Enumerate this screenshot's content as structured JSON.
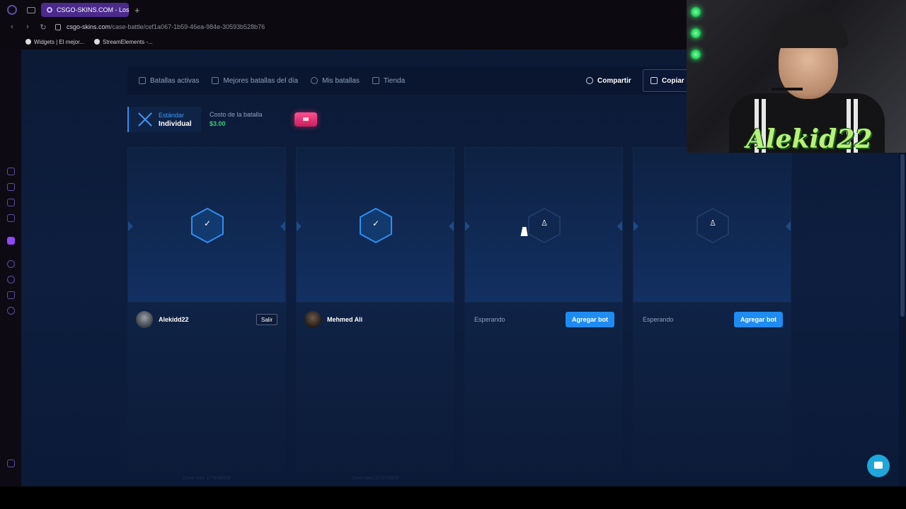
{
  "browser": {
    "tab_title": "CSGO-SKINS.COM - Los m",
    "url_host": "csgo-skins.com",
    "url_path": "/case-battle/cef1a067-1b59-46ea-984e-30593b528b76",
    "bookmarks": [
      {
        "label": "Widgets | El mejor..."
      },
      {
        "label": "StreamElements -..."
      }
    ]
  },
  "topnav": {
    "items": [
      {
        "label": "Batallas activas",
        "icon": "swords-icon"
      },
      {
        "label": "Mejores batallas del día",
        "icon": "trophy-icon"
      },
      {
        "label": "Mis batallas",
        "icon": "history-icon"
      },
      {
        "label": "Tienda",
        "icon": "basket-icon"
      }
    ],
    "share_label": "Compartir",
    "copy_label": "Copiar l"
  },
  "battle": {
    "mode_label": "Estándar",
    "mode_value": "Individual",
    "cost_label": "Costo de la batalla",
    "cost_value": "$3.00"
  },
  "slots": [
    {
      "state": "ready",
      "player": "Alekidd22",
      "action": "Salir",
      "seed": "Client seed: 1774058978"
    },
    {
      "state": "ready",
      "player": "Mehmed Ali",
      "action": "",
      "seed": "Client seed: 1776719509"
    },
    {
      "state": "waiting",
      "status": "Esperando",
      "action": "Agregar bot",
      "seed": ""
    },
    {
      "state": "waiting",
      "status": "Esperando",
      "action": "Agregar bot",
      "seed": ""
    }
  ],
  "webcam": {
    "overlay_name": "Alekid22"
  },
  "colors": {
    "accent": "#1e8cf0",
    "cost_green": "#35d07f",
    "page_bg": "#0d1e3f"
  }
}
